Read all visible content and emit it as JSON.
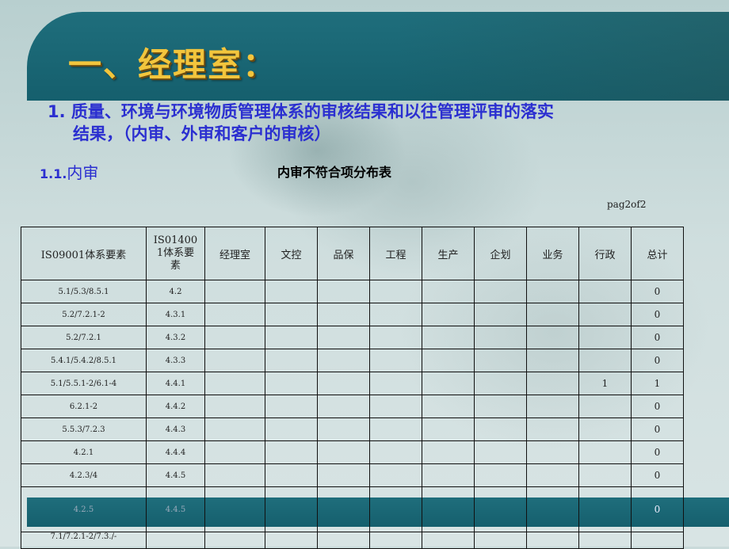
{
  "heading": "一、经理室：",
  "subtitle_line1": "1. 质量、环境与环境物质管理体系的审核结果和以往管理评审的落实",
  "subtitle_line2": "结果，（内审、外审和客户的审核）",
  "section_number": "1.1.",
  "section_label": "内审",
  "table_title": "内审不符合项分布表",
  "page_label": "pag2of2",
  "columns": [
    "IS09001体系要素",
    "IS014001体系要素",
    "经理室",
    "文控",
    "品保",
    "工程",
    "生产",
    "企划",
    "业务",
    "行政",
    "总计"
  ],
  "rows": [
    {
      "iso9001": "5.1/5.3/8.5.1",
      "iso14001": "4.2",
      "cells": [
        "",
        "",
        "",
        "",
        "",
        "",
        "",
        ""
      ],
      "total": "0"
    },
    {
      "iso9001": "5.2/7.2.1-2",
      "iso14001": "4.3.1",
      "cells": [
        "",
        "",
        "",
        "",
        "",
        "",
        "",
        ""
      ],
      "total": "0"
    },
    {
      "iso9001": "5.2/7.2.1",
      "iso14001": "4.3.2",
      "cells": [
        "",
        "",
        "",
        "",
        "",
        "",
        "",
        ""
      ],
      "total": "0"
    },
    {
      "iso9001": "5.4.1/5.4.2/8.5.1",
      "iso14001": "4.3.3",
      "cells": [
        "",
        "",
        "",
        "",
        "",
        "",
        "",
        ""
      ],
      "total": "0"
    },
    {
      "iso9001": "5.1/5.5.1-2/6.1-4",
      "iso14001": "4.4.1",
      "cells": [
        "",
        "",
        "",
        "",
        "",
        "",
        "",
        "1"
      ],
      "total": "1"
    },
    {
      "iso9001": "6.2.1-2",
      "iso14001": "4.4.2",
      "cells": [
        "",
        "",
        "",
        "",
        "",
        "",
        "",
        ""
      ],
      "total": "0"
    },
    {
      "iso9001": "5.5.3/7.2.3",
      "iso14001": "4.4.3",
      "cells": [
        "",
        "",
        "",
        "",
        "",
        "",
        "",
        ""
      ],
      "total": "0"
    },
    {
      "iso9001": "4.2.1",
      "iso14001": "4.4.4",
      "cells": [
        "",
        "",
        "",
        "",
        "",
        "",
        "",
        ""
      ],
      "total": "0"
    },
    {
      "iso9001": "4.2.3/4",
      "iso14001": "4.4.5",
      "cells": [
        "",
        "",
        "",
        "",
        "",
        "",
        "",
        ""
      ],
      "total": "0"
    },
    {
      "iso9001": "4.2.5",
      "iso14001": "4.4.5",
      "cells": [
        "",
        "",
        "",
        "",
        "",
        "",
        "",
        ""
      ],
      "total": "0"
    },
    {
      "iso9001": "7.1/7.2.1-2/7.3./-",
      "iso14001": "",
      "cells": [
        "",
        "",
        "",
        "",
        "",
        "",
        "",
        ""
      ],
      "total": ""
    }
  ],
  "colors": {
    "band": "#1b6675",
    "heading": "#f2c53d",
    "subtitle": "#2b2fd0"
  }
}
